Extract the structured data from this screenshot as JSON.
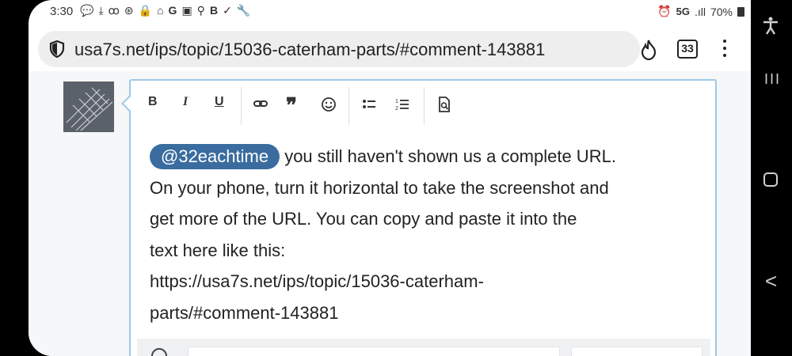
{
  "status_bar": {
    "time": "3:30",
    "network": "5G",
    "signal": ".ıll",
    "battery": "70%"
  },
  "browser": {
    "url": "usa7s.net/ips/topic/15036-caterham-parts/#comment-143881",
    "tab_count": "33"
  },
  "toolbar": {
    "bold": "B",
    "italic": "I",
    "underline": "U",
    "quote": "”"
  },
  "editor": {
    "mention": "@32eachtime",
    "text_1": " you still haven't shown us a complete URL.",
    "text_2": "On your phone, turn it horizontal to take the screenshot and",
    "text_3": "get more of the URL.  You can copy and paste it into the",
    "text_4": "text here like this:",
    "text_5": "https://usa7s.net/ips/topic/15036-caterham-",
    "text_6": "parts/#comment-143881"
  },
  "nav": {
    "recent": "III",
    "back": "<"
  },
  "colors": {
    "mention_bg": "#3a6c9f",
    "editor_border": "#9ec8e6"
  }
}
